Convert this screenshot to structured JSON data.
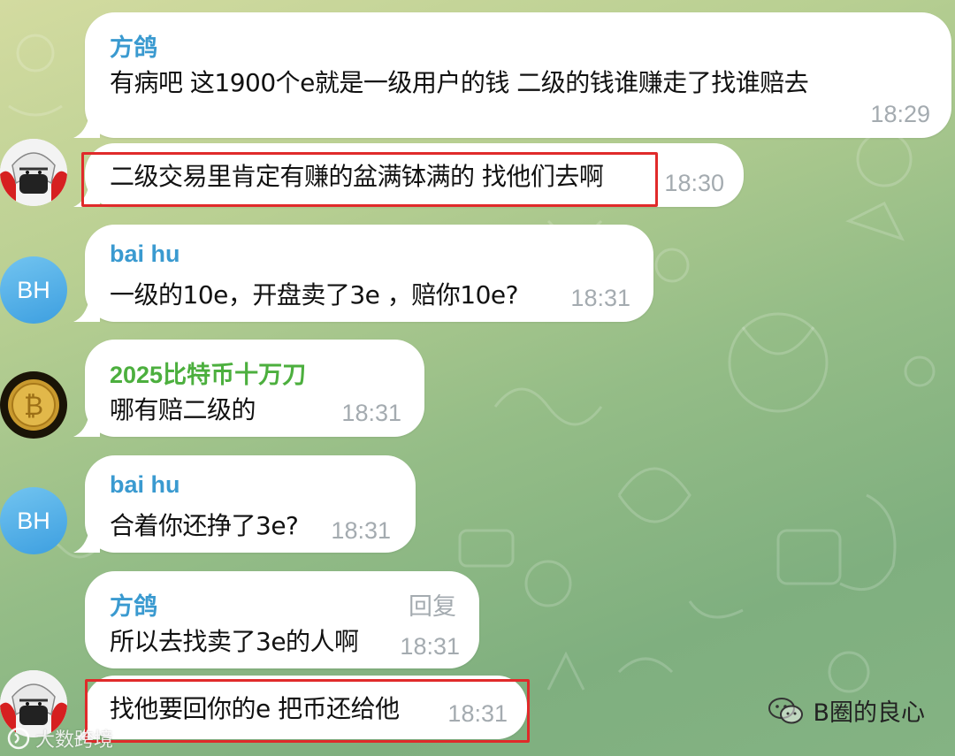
{
  "messages": [
    {
      "id": "m1",
      "sender": "方鸽",
      "text": "有病吧 这1900个e就是一级用户的钱  二级的钱谁赚走了找谁赔去",
      "time": "18:29",
      "sender_color": "#3a9ad0"
    },
    {
      "id": "m2",
      "sender": "",
      "text": "二级交易里肯定有赚的盆满钵满的  找他们去啊",
      "time": "18:30",
      "highlighted": true
    },
    {
      "id": "m3",
      "sender": "bai hu",
      "text": "一级的10e，开盘卖了3e ，赔你10e?",
      "time": "18:31",
      "sender_color": "#3a9ad0",
      "avatar_initials": "BH"
    },
    {
      "id": "m4",
      "sender": "2025比特币十万刀",
      "text": "哪有赔二级的",
      "time": "18:31",
      "sender_color": "#4caf3e"
    },
    {
      "id": "m5",
      "sender": "bai hu",
      "text": "合着你还挣了3e?",
      "time": "18:31",
      "sender_color": "#3a9ad0",
      "avatar_initials": "BH"
    },
    {
      "id": "m6",
      "sender": "方鸽",
      "text": "所以去找卖了3e的人啊",
      "time": "18:31",
      "sender_color": "#3a9ad0",
      "reply_label": "回复"
    },
    {
      "id": "m7",
      "sender": "",
      "text": "找他要回你的e  把币还给他",
      "time": "18:31",
      "highlighted": true
    }
  ],
  "watermark_left": "大数跨境",
  "watermark_right": "B圈的良心",
  "colors": {
    "highlight": "#e02a2a",
    "bubble": "#ffffff",
    "time": "#a4abb0"
  }
}
